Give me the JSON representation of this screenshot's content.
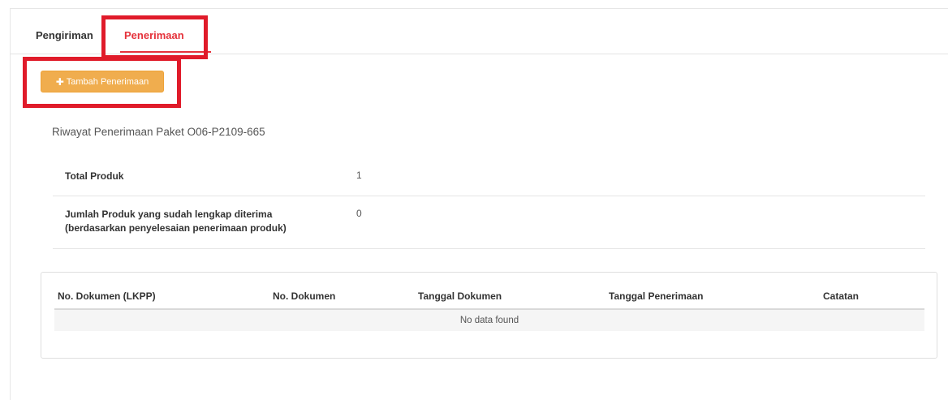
{
  "tabs": [
    {
      "label": "Pengiriman",
      "active": false
    },
    {
      "label": "Penerimaan",
      "active": true
    }
  ],
  "add_button": {
    "icon": "plus-icon",
    "label": "Tambah Penerimaan"
  },
  "history_title": "Riwayat Penerimaan Paket O06-P2109-665",
  "summary": [
    {
      "label": "Total Produk",
      "value": "1"
    },
    {
      "label_line1": "Jumlah Produk yang sudah lengkap diterima",
      "label_line2": "(berdasarkan penyelesaian penerimaan produk)",
      "value": "0"
    }
  ],
  "table": {
    "headers": [
      "No. Dokumen (LKPP)",
      "No. Dokumen",
      "Tanggal Dokumen",
      "Tanggal Penerimaan",
      "Catatan"
    ],
    "empty_text": "No data found"
  },
  "colors": {
    "active_tab": "#e5323b",
    "button": "#f0ad4e",
    "highlight": "#e01b2a"
  }
}
